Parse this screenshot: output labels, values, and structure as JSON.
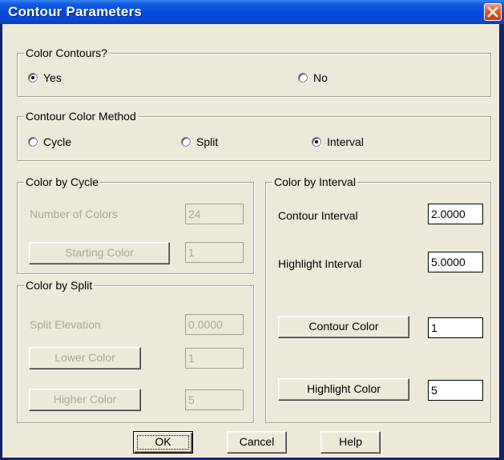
{
  "window": {
    "title": "Contour Parameters"
  },
  "color_contours": {
    "legend": "Color Contours?",
    "options": [
      {
        "label": "Yes",
        "selected": true
      },
      {
        "label": "No",
        "selected": false
      }
    ]
  },
  "method": {
    "legend": "Contour Color Method",
    "options": [
      {
        "label": "Cycle",
        "selected": false
      },
      {
        "label": "Split",
        "selected": false
      },
      {
        "label": "Interval",
        "selected": true
      }
    ]
  },
  "cycle": {
    "legend": "Color by Cycle",
    "num_colors_label": "Number of Colors",
    "num_colors_value": "24",
    "starting_color_button": "Starting Color",
    "starting_color_value": "1"
  },
  "split": {
    "legend": "Color by Split",
    "elevation_label": "Split Elevation",
    "elevation_value": "0.0000",
    "lower_color_button": "Lower Color",
    "lower_color_value": "1",
    "higher_color_button": "Higher Color",
    "higher_color_value": "5"
  },
  "interval": {
    "legend": "Color by Interval",
    "contour_interval_label": "Contour Interval",
    "contour_interval_value": "2.0000",
    "highlight_interval_label": "Highlight Interval",
    "highlight_interval_value": "5.0000",
    "contour_color_button": "Contour Color",
    "contour_color_value": "1",
    "highlight_color_button": "Highlight Color",
    "highlight_color_value": "5"
  },
  "buttons": {
    "ok": "OK",
    "cancel": "Cancel",
    "help": "Help"
  },
  "colors": {
    "title_blue": "#0548d9",
    "dialog_bg": "#ece9d8",
    "disabled_text": "#aca899",
    "close_red": "#e2572d"
  }
}
